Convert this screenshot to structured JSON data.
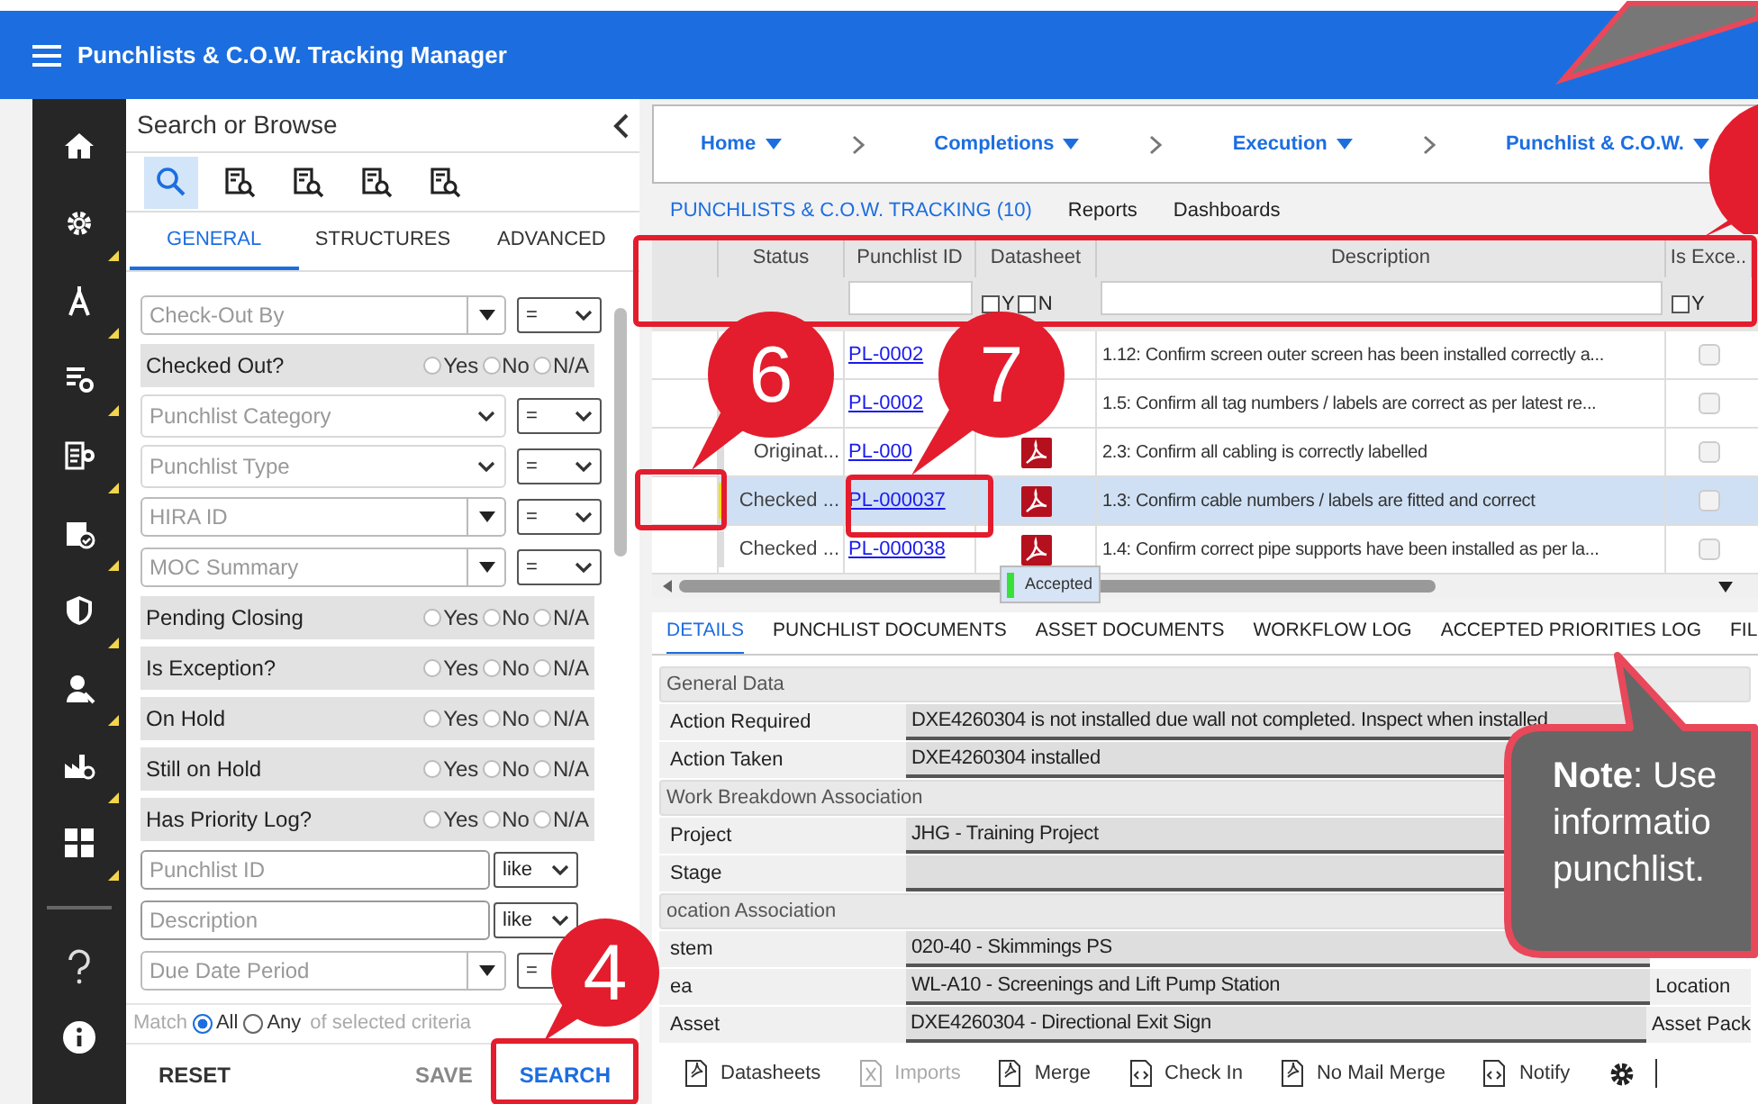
{
  "app": {
    "title": "Punchlists & C.O.W. Tracking Manager"
  },
  "search_panel": {
    "title": "Search or Browse",
    "tools": [
      {
        "selected": true
      },
      {
        "selected": false
      },
      {
        "selected": false
      },
      {
        "selected": false
      },
      {
        "selected": false
      }
    ],
    "tabs": [
      {
        "label": "GENERAL",
        "selected": true
      },
      {
        "label": "STRUCTURES",
        "selected": false
      },
      {
        "label": "ADVANCED",
        "selected": false
      }
    ],
    "filters": [
      {
        "kind": "dropdown",
        "placeholder": "Check-Out By",
        "operator": "="
      },
      {
        "kind": "yes_no",
        "label": "Checked Out?",
        "options": [
          {
            "label": "Yes",
            "checked": false
          },
          {
            "label": "No",
            "checked": false
          },
          {
            "label": "N/A",
            "checked": false
          }
        ]
      },
      {
        "kind": "combo",
        "placeholder": "Punchlist Category",
        "operator": "="
      },
      {
        "kind": "combo",
        "placeholder": "Punchlist Type",
        "operator": "="
      },
      {
        "kind": "dropdown",
        "placeholder": "HIRA ID",
        "operator": "="
      },
      {
        "kind": "dropdown",
        "placeholder": "MOC Summary",
        "operator": "="
      },
      {
        "kind": "yes_no",
        "label": "Pending Closing",
        "options": [
          {
            "label": "Yes",
            "checked": false
          },
          {
            "label": "No",
            "checked": false
          },
          {
            "label": "N/A",
            "checked": false
          }
        ]
      },
      {
        "kind": "yes_no",
        "label": "Is Exception?",
        "options": [
          {
            "label": "Yes",
            "checked": false
          },
          {
            "label": "No",
            "checked": false
          },
          {
            "label": "N/A",
            "checked": false
          }
        ]
      },
      {
        "kind": "yes_no",
        "label": "On Hold",
        "options": [
          {
            "label": "Yes",
            "checked": false
          },
          {
            "label": "No",
            "checked": false
          },
          {
            "label": "N/A",
            "checked": false
          }
        ]
      },
      {
        "kind": "yes_no",
        "label": "Still on Hold",
        "options": [
          {
            "label": "Yes",
            "checked": false
          },
          {
            "label": "No",
            "checked": false
          },
          {
            "label": "N/A",
            "checked": false
          }
        ]
      },
      {
        "kind": "yes_no",
        "label": "Has Priority Log?",
        "options": [
          {
            "label": "Yes",
            "checked": false
          },
          {
            "label": "No",
            "checked": false
          },
          {
            "label": "N/A",
            "checked": false
          }
        ]
      },
      {
        "kind": "text",
        "placeholder": "Punchlist ID",
        "operator": "like"
      },
      {
        "kind": "text",
        "placeholder": "Description",
        "operator": "like"
      },
      {
        "kind": "dropdown",
        "placeholder": "Due Date Period",
        "operator": "="
      }
    ],
    "match": {
      "label": "Match",
      "options": [
        {
          "label": "All",
          "selected": true
        },
        {
          "label": "Any",
          "selected": false
        }
      ],
      "suffix": "of selected criteria"
    },
    "actions": [
      {
        "label": "RESET",
        "kind": "plain"
      },
      {
        "label": "SAVE",
        "kind": "muted"
      },
      {
        "label": "SEARCH",
        "kind": "primary"
      }
    ]
  },
  "breadcrumb": [
    {
      "label": "Home"
    },
    {
      "label": "Completions"
    },
    {
      "label": "Execution"
    },
    {
      "label": "Punchlist & C.O.W."
    }
  ],
  "view_tabs": [
    {
      "label": "PUNCHLISTS & C.O.W. TRACKING (10)",
      "selected": true
    },
    {
      "label": "Reports",
      "selected": false
    },
    {
      "label": "Dashboards",
      "selected": false
    }
  ],
  "grid": {
    "columns": [
      {
        "label": "Status",
        "kind": "plain"
      },
      {
        "label": "Punchlist ID",
        "kind": "text_filter"
      },
      {
        "label": "Datasheet",
        "kind": "check_filter",
        "filter_options": [
          {
            "label": "Y",
            "checked": false
          },
          {
            "label": "N",
            "checked": false
          }
        ]
      },
      {
        "label": "Description",
        "kind": "text_filter"
      },
      {
        "label": "Is Exce..",
        "kind": "check_filter",
        "filter_options": [
          {
            "label": "Y",
            "checked": false
          }
        ]
      }
    ],
    "rows": [
      {
        "id": "PL-0002",
        "description": "1.12: Confirm screen outer screen has been installed correctly a...",
        "exception": false,
        "selected": false
      },
      {
        "id": "PL-0002",
        "description": "1.5: Confirm all tag numbers / labels are correct as per latest re...",
        "exception": false,
        "selected": false
      },
      {
        "status": "Originat...",
        "id": "PL-000",
        "datasheet": true,
        "description": "2.3: Confirm all cabling is correctly labelled",
        "exception": false,
        "selected": false
      },
      {
        "status": "Checked ...",
        "id": "PL-000037",
        "datasheet": true,
        "description": "1.3: Confirm cable numbers / labels are fitted and correct",
        "exception": false,
        "selected": true
      },
      {
        "status": "Checked ...",
        "id": "PL-000038",
        "datasheet": true,
        "description": "1.4: Confirm correct pipe supports have been installed as per la...",
        "exception": false,
        "selected": false
      }
    ],
    "tooltip": "Accepted"
  },
  "detail_tabs": [
    {
      "label": "DETAILS",
      "selected": true
    },
    {
      "label": "PUNCHLIST DOCUMENTS",
      "selected": false
    },
    {
      "label": "ASSET DOCUMENTS",
      "selected": false
    },
    {
      "label": "WORKFLOW LOG",
      "selected": false
    },
    {
      "label": "ACCEPTED PRIORITIES LOG",
      "selected": false
    },
    {
      "label": "FIL",
      "selected": false
    }
  ],
  "details": [
    {
      "kind": "section",
      "label": "General Data"
    },
    {
      "kind": "field",
      "label": "Action Required",
      "value": "DXE4260304 is not installed due wall not completed. Inspect when installed"
    },
    {
      "kind": "field",
      "label": "Action Taken",
      "value": "DXE4260304 installed"
    },
    {
      "kind": "section",
      "label": "Work Breakdown Association"
    },
    {
      "kind": "field",
      "label": "Project",
      "value": "JHG - Training Project"
    },
    {
      "kind": "field",
      "label": "Stage"
    },
    {
      "kind": "section",
      "label": "ocation Association"
    },
    {
      "kind": "field",
      "label": "stem",
      "value": "020-40 - Skimmings PS"
    },
    {
      "kind": "field",
      "label": "ea",
      "value": "WL-A10 - Screenings and Lift Pump Station",
      "side": "Location"
    },
    {
      "kind": "field",
      "label": "Asset",
      "value": "DXE4260304 - Directional Exit Sign",
      "side": "Asset Pack"
    }
  ],
  "toolbar": [
    {
      "label": "Datasheets",
      "kind": "pdf",
      "disabled": false
    },
    {
      "label": "Imports",
      "kind": "excel",
      "disabled": true
    },
    {
      "label": "Merge",
      "kind": "pdf",
      "disabled": false
    },
    {
      "label": "Check In",
      "kind": "code",
      "disabled": false
    },
    {
      "label": "No Mail Merge",
      "kind": "pdf",
      "disabled": false
    },
    {
      "label": "Notify",
      "kind": "code",
      "disabled": false
    }
  ],
  "callouts": [
    {
      "number": "4"
    },
    {
      "number": "6"
    },
    {
      "number": "7"
    }
  ],
  "note": {
    "lines": [
      "**Note**: Use",
      "informatio",
      "punchlist."
    ]
  }
}
